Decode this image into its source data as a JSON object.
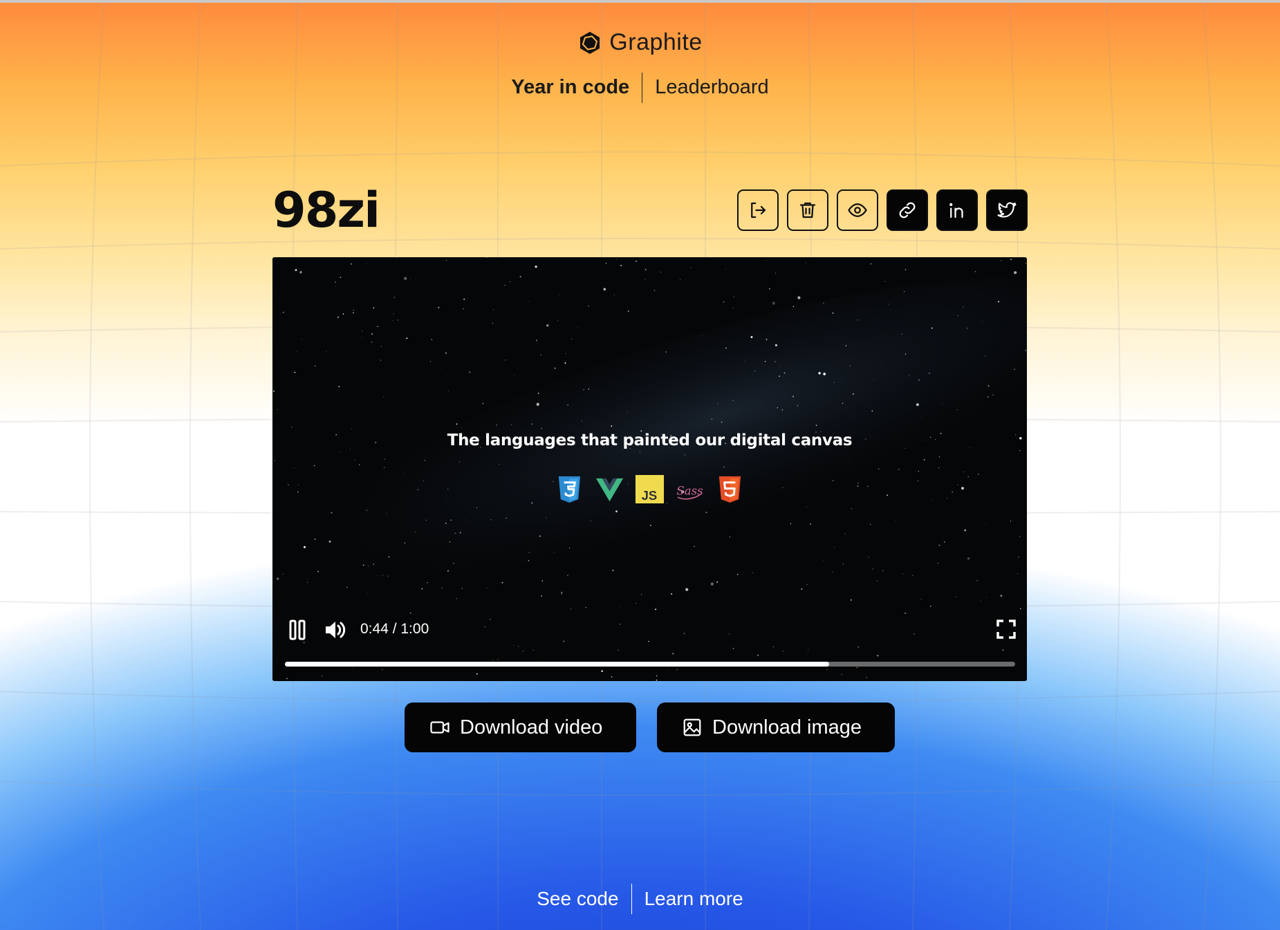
{
  "brand": {
    "name": "Graphite",
    "logo_icon": "graphite-hexagon-logo-icon"
  },
  "nav": {
    "items": [
      {
        "label": "Year in code",
        "active": true
      },
      {
        "label": "Leaderboard",
        "active": false
      }
    ]
  },
  "profile": {
    "username": "98zi"
  },
  "actions": [
    {
      "name": "sign-out",
      "icon": "sign-out-icon",
      "style": "outline"
    },
    {
      "name": "delete",
      "icon": "trash-icon",
      "style": "outline"
    },
    {
      "name": "visibility",
      "icon": "eye-icon",
      "style": "outline"
    },
    {
      "name": "copy-link",
      "icon": "link-icon",
      "style": "filled"
    },
    {
      "name": "share-linkedin",
      "icon": "linkedin-icon",
      "style": "filled"
    },
    {
      "name": "share-twitter",
      "icon": "twitter-icon",
      "style": "filled"
    }
  ],
  "video": {
    "overlay_title": "The languages that painted our digital canvas",
    "languages": [
      "CSS3",
      "Vue",
      "JavaScript",
      "Sass",
      "HTML5"
    ],
    "language_label_js": "JS",
    "language_label_sass": "Sass",
    "current_time": "0:44",
    "duration": "1:00",
    "time_display": "0:44 / 1:00",
    "progress": 0.745,
    "state": "playing"
  },
  "downloads": {
    "video_label": "Download video",
    "image_label": "Download image"
  },
  "footer": {
    "see_code": "See code",
    "learn_more": "Learn more"
  },
  "colors": {
    "button_bg": "#050505",
    "gradient_top": "#ff8a3d",
    "gradient_bottom": "#1d3fc6",
    "css3": "#2c8ad1",
    "vue": "#41b883",
    "js": "#f0db4f",
    "sass": "#cd6799",
    "html5": "#e44d26"
  }
}
